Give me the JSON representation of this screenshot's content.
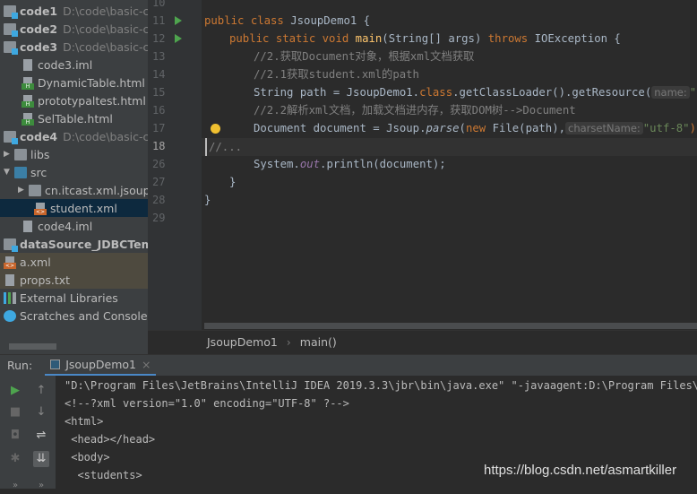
{
  "project_tree": [
    {
      "label": "code1",
      "path": "D:\\code\\basic-co",
      "type": "module"
    },
    {
      "label": "code2",
      "path": "D:\\code\\basic-co",
      "type": "module"
    },
    {
      "label": "code3",
      "path": "D:\\code\\basic-co",
      "type": "module"
    },
    {
      "label": "code3.iml",
      "type": "iml"
    },
    {
      "label": "DynamicTable.html",
      "type": "html"
    },
    {
      "label": "prototypaltest.html",
      "type": "html"
    },
    {
      "label": "SelTable.html",
      "type": "html"
    },
    {
      "label": "code4",
      "path": "D:\\code\\basic-co",
      "type": "module"
    },
    {
      "label": "libs",
      "type": "folder"
    },
    {
      "label": "src",
      "type": "src"
    },
    {
      "label": "cn.itcast.xml.jsoup",
      "type": "package"
    },
    {
      "label": "student.xml",
      "type": "xml",
      "selected": true
    },
    {
      "label": "code4.iml",
      "type": "iml"
    },
    {
      "label": "dataSource_JDBCTempl",
      "type": "module"
    },
    {
      "label": "a.xml",
      "type": "xml"
    },
    {
      "label": "props.txt",
      "type": "txt"
    },
    {
      "label": "External Libraries",
      "type": "libraries"
    },
    {
      "label": "Scratches and Consoles",
      "type": "scratches"
    }
  ],
  "editor": {
    "line_numbers": [
      "10",
      "11",
      "12",
      "13",
      "14",
      "15",
      "16",
      "17",
      "18",
      "26",
      "27",
      "28",
      "29"
    ],
    "code": {
      "l11_kw": "public class ",
      "l11_name": "JsoupDemo1 {",
      "l12_kw": "public static void ",
      "l12_fn": "main",
      "l12_a": "(String[] args) ",
      "l12_kw2": "throws ",
      "l12_b": "IOException {",
      "l13": "//2.获取Document对象，根据xml文档获取",
      "l14": "//2.1获取student.xml的path",
      "l15_a": "String path = JsoupDemo1.",
      "l15_kw": "class",
      ".l15_b": "",
      "l15_b": ".getClassLoader().getResource(",
      "l15_hint": "name:",
      "l15_st": "\"stu",
      "l16": "//2.2解析xml文档，加载文档进内存，获取DOM树-->Document",
      "l17_a": "Document document = Jsoup.",
      "l17_it": "parse",
      "l17_b": "(",
      "l17_kw": "new ",
      "l17_c": "File(path),",
      "l17_hint": "charsetName:",
      "l17_st": "\"utf-8\"",
      "l17_d": ");",
      "l18": "//...",
      "l26_a": "System.",
      "l26_it": "out",
      "l26_b": ".println(document);",
      "l27": "}",
      "l28": "}"
    }
  },
  "breadcrumb": [
    "JsoupDemo1",
    "main()"
  ],
  "run": {
    "label": "Run:",
    "tab": "JsoupDemo1"
  },
  "console": [
    "\"D:\\Program Files\\JetBrains\\IntelliJ IDEA 2019.3.3\\jbr\\bin\\java.exe\" \"-javaagent:D:\\Program Files\\JetBrains",
    "<!--?xml version=\"1.0\" encoding=\"UTF-8\" ?-->",
    "<html>",
    " <head></head>",
    " <body>",
    "  <students>"
  ],
  "watermark": "https://blog.csdn.net/asmartkiller",
  "colors": {
    "keyword": "#cc7832",
    "comment": "#808080",
    "string": "#6a8759",
    "method": "#ffc66d",
    "field": "#9876aa",
    "selection": "#0d293e"
  }
}
